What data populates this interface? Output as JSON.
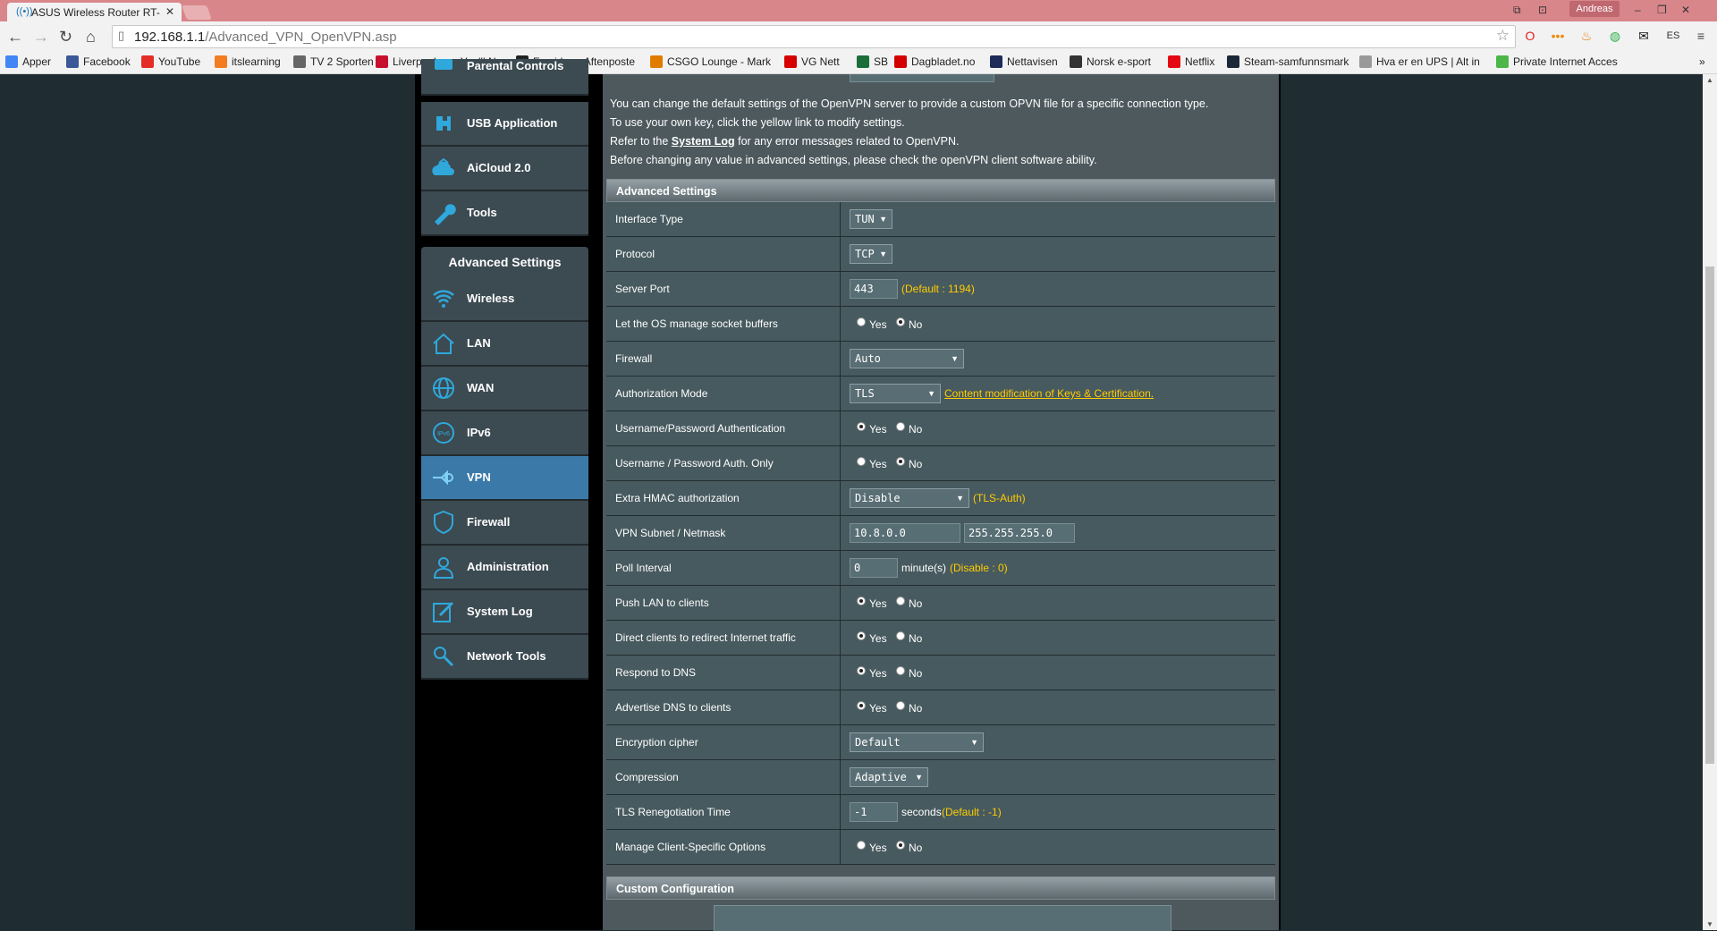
{
  "browser": {
    "tab_title": "ASUS Wireless Router RT-",
    "tab_close": "✕",
    "user": "Andreas",
    "url_host": "192.168.1.1",
    "url_path": "/Advanced_VPN_OpenVPN.asp"
  },
  "bookmarks": [
    {
      "label": "Apper",
      "icon": "apps-icon",
      "color": "#4285f4"
    },
    {
      "label": "Facebook",
      "icon": "facebook-icon",
      "color": "#3b5998"
    },
    {
      "label": "YouTube",
      "icon": "youtube-icon",
      "color": "#e52d27"
    },
    {
      "label": "itslearning",
      "icon": "itslearning-icon",
      "color": "#f47c20"
    },
    {
      "label": "TV 2 Sporten",
      "icon": "tv2-icon",
      "color": "#666666"
    },
    {
      "label": "Liverpool.no - You'll N",
      "icon": "liverpool-icon",
      "color": "#c8102e"
    },
    {
      "label": "Forsiden - Aftenposte",
      "icon": "aftenposten-icon",
      "color": "#222222"
    },
    {
      "label": "CSGO Lounge - Mark",
      "icon": "csgo-icon",
      "color": "#e07b00"
    },
    {
      "label": "VG Nett",
      "icon": "vg-icon",
      "color": "#d60000"
    },
    {
      "label": "SB",
      "icon": "sb-icon",
      "color": "#1b6e3a"
    },
    {
      "label": "Dagbladet.no",
      "icon": "dagbladet-icon",
      "color": "#d40000"
    },
    {
      "label": "Nettavisen",
      "icon": "nettavisen-icon",
      "color": "#1d2b5a"
    },
    {
      "label": "Norsk e-sport",
      "icon": "esport-icon",
      "color": "#333333"
    },
    {
      "label": "Netflix",
      "icon": "netflix-icon",
      "color": "#e50914"
    },
    {
      "label": "Steam-samfunnsmark",
      "icon": "steam-icon",
      "color": "#1b2838"
    },
    {
      "label": "Hva er en UPS | Alt in",
      "icon": "page-icon",
      "color": "#999999"
    },
    {
      "label": "Private Internet Acces",
      "icon": "pia-icon",
      "color": "#4cb649"
    }
  ],
  "sidebar": {
    "top_items": [
      {
        "label": "Parental Controls",
        "icon": "parental-icon"
      },
      {
        "label": "USB Application",
        "icon": "usb-icon"
      },
      {
        "label": "AiCloud 2.0",
        "icon": "cloud-icon"
      },
      {
        "label": "Tools",
        "icon": "tools-icon"
      }
    ],
    "advanced_header": "Advanced Settings",
    "advanced_items": [
      {
        "label": "Wireless",
        "icon": "wireless-icon"
      },
      {
        "label": "LAN",
        "icon": "lan-icon"
      },
      {
        "label": "WAN",
        "icon": "wan-icon"
      },
      {
        "label": "IPv6",
        "icon": "ipv6-icon"
      },
      {
        "label": "VPN",
        "icon": "vpn-icon",
        "active": true
      },
      {
        "label": "Firewall",
        "icon": "firewall-icon"
      },
      {
        "label": "Administration",
        "icon": "administration-icon"
      },
      {
        "label": "System Log",
        "icon": "systemlog-icon"
      },
      {
        "label": "Network Tools",
        "icon": "networktools-icon"
      }
    ]
  },
  "info": {
    "line1": "You can change the default settings of the OpenVPN server to provide a custom OPVN file for a specific connection type.",
    "line2": "To use your own key, click the yellow link to modify settings.",
    "line3_pre": "Refer to the ",
    "line3_link": "System Log",
    "line3_post": " for any error messages related to OpenVPN.",
    "line4": "Before changing any value in advanced settings, please check the openVPN client software ability."
  },
  "advanced": {
    "title": "Advanced Settings",
    "yes": "Yes",
    "no": "No",
    "interface_type": {
      "label": "Interface Type",
      "value": "TUN"
    },
    "protocol": {
      "label": "Protocol",
      "value": "TCP"
    },
    "server_port": {
      "label": "Server Port",
      "value": "443",
      "note": "(Default : 1194)"
    },
    "socket_buffers": {
      "label": "Let the OS manage socket buffers",
      "selected": "No"
    },
    "firewall": {
      "label": "Firewall",
      "value": "Auto"
    },
    "auth_mode": {
      "label": "Authorization Mode",
      "value": "TLS",
      "link": "Content modification of Keys & Certification."
    },
    "userpass_auth": {
      "label": "Username/Password Authentication",
      "selected": "Yes"
    },
    "userpass_only": {
      "label": "Username / Password Auth. Only",
      "selected": "No"
    },
    "hmac": {
      "label": "Extra HMAC authorization",
      "value": "Disable",
      "note": "(TLS-Auth)"
    },
    "subnet": {
      "label": "VPN Subnet / Netmask",
      "subnet": "10.8.0.0",
      "netmask": "255.255.255.0"
    },
    "poll": {
      "label": "Poll Interval",
      "value": "0",
      "unit": "minute(s)",
      "note": "(Disable : 0)"
    },
    "push_lan": {
      "label": "Push LAN to clients",
      "selected": "Yes"
    },
    "redirect": {
      "label": "Direct clients to redirect Internet traffic",
      "selected": "Yes"
    },
    "respond_dns": {
      "label": "Respond to DNS",
      "selected": "Yes"
    },
    "advertise_dns": {
      "label": "Advertise DNS to clients",
      "selected": "Yes"
    },
    "cipher": {
      "label": "Encryption cipher",
      "value": "Default"
    },
    "compression": {
      "label": "Compression",
      "value": "Adaptive"
    },
    "tls_reneg": {
      "label": "TLS Renegotiation Time",
      "value": "-1",
      "unit": "seconds",
      "note": "(Default : -1)"
    },
    "client_specific": {
      "label": "Manage Client-Specific Options",
      "selected": "No"
    }
  },
  "custom": {
    "title": "Custom Configuration"
  }
}
